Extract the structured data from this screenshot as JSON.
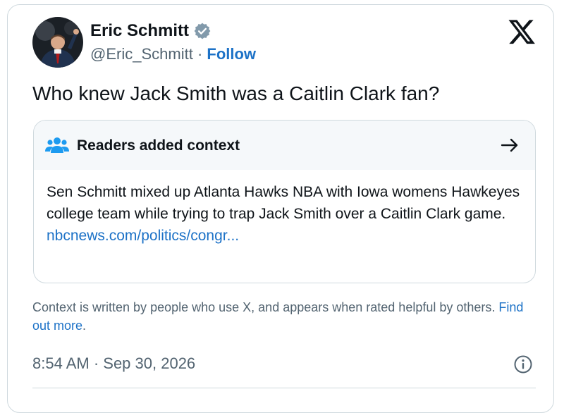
{
  "author": {
    "name": "Eric Schmitt",
    "handle": "@Eric_Schmitt",
    "separator": "·",
    "follow_label": "Follow",
    "avatar_icon": "profile-photo",
    "verified_icon": "verified-badge-icon"
  },
  "platform_icon": "x-logo-icon",
  "tweet": {
    "text": "Who knew Jack Smith was a Caitlin Clark fan?"
  },
  "context_note": {
    "title": "Readers added context",
    "header_icon": "people-icon",
    "arrow_icon": "arrow-right-icon",
    "body": "Sen Schmitt mixed up Atlanta Hawks NBA with Iowa womens Hawkeyes college team while trying to trap Jack Smith over a Caitlin Clark game.",
    "link": "nbcnews.com/politics/congr..."
  },
  "footnote": {
    "text": "Context is written by people who use X, and appears when rated helpful by others.",
    "link": "Find out more",
    "trailing": "."
  },
  "timestamp": "8:54 AM · Sep 30, 2026",
  "info_icon": "info-icon",
  "colors": {
    "link_blue": "#1d72c7",
    "secondary_text": "#536471",
    "border": "#cfd9de",
    "context_header_bg": "#f5f8fa",
    "verified_gray": "#829aab",
    "people_icon_blue": "#1d9bf0"
  }
}
